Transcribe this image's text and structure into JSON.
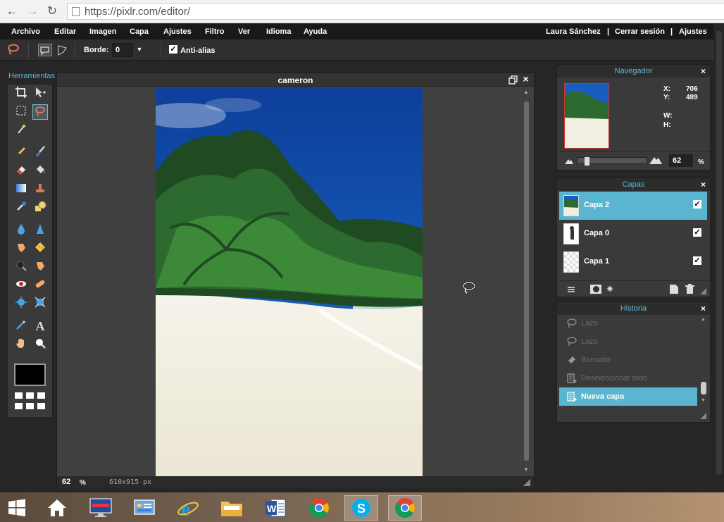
{
  "browser": {
    "url": "https://pixlr.com/editor/"
  },
  "menu": [
    "Archivo",
    "Editar",
    "Imagen",
    "Capa",
    "Ajustes",
    "Filtro",
    "Ver",
    "Idioma",
    "Ayuda"
  ],
  "user": {
    "name": "Laura Sánchez",
    "logout": "Cerrar sesión",
    "settings": "Ajustes",
    "separator": "|"
  },
  "options": {
    "border_label": "Borde:",
    "border_value": "0",
    "antialias_label": "Anti-alias",
    "antialias_checked": true
  },
  "tools": {
    "title": "Herramientas",
    "foreground_color": "#000000"
  },
  "document": {
    "title": "cameron",
    "zoom": "62",
    "zoom_unit": "%",
    "size": "610x915 px"
  },
  "navigator": {
    "title": "Navegador",
    "x_label": "X:",
    "x_value": "706",
    "y_label": "Y:",
    "y_value": "489",
    "w_label": "W:",
    "h_label": "H:",
    "zoom": "62",
    "zoom_unit": "%"
  },
  "layers": {
    "title": "Capas",
    "items": [
      {
        "name": "Capa 2",
        "visible": true,
        "selected": true
      },
      {
        "name": "Capa 0",
        "visible": true,
        "selected": false
      },
      {
        "name": "Capa 1",
        "visible": true,
        "selected": false
      }
    ]
  },
  "history": {
    "title": "Historia",
    "items": [
      {
        "label": "Lazo",
        "icon": "lasso-icon"
      },
      {
        "label": "Lazo",
        "icon": "lasso-icon"
      },
      {
        "label": "Borrador",
        "icon": "eraser-icon"
      },
      {
        "label": "Deseleccionar todo",
        "icon": "document-icon"
      },
      {
        "label": "Nueva capa",
        "icon": "document-icon",
        "selected": true
      }
    ]
  },
  "colors": {
    "accent": "#5ab6d0",
    "title_text": "#5fb8d4"
  }
}
